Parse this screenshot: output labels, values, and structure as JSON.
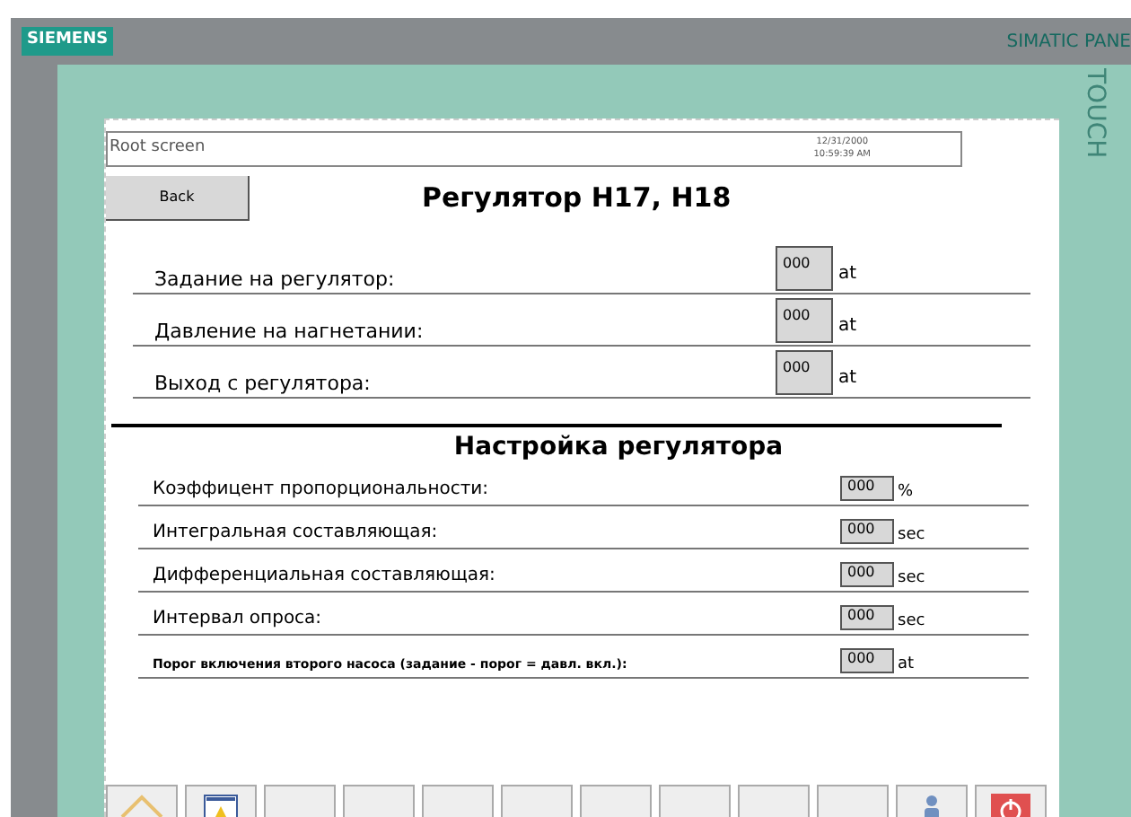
{
  "device": {
    "brand": "SIEMENS",
    "model": "SIMATIC PANE",
    "side_label": "TOUCH"
  },
  "header": {
    "screen_name": "Root screen",
    "date": "12/31/2000",
    "time": "10:59:39 AM"
  },
  "back_button": "Back",
  "title": "Регулятор H17, H18",
  "rows": [
    {
      "label": "Задание на регулятор:",
      "value": "000",
      "unit": "at"
    },
    {
      "label": "Давление на нагнетании:",
      "value": "000",
      "unit": "at"
    },
    {
      "label": "Выход с регулятора:",
      "value": "000",
      "unit": "at"
    }
  ],
  "section_title": "Настройка регулятора",
  "settings": [
    {
      "label": "Коэффицент пропорциональности:",
      "value": "000",
      "unit": "%",
      "small": false
    },
    {
      "label": "Интегральная составляющая:",
      "value": "000",
      "unit": "sec",
      "small": false
    },
    {
      "label": "Дифференциальная составляющая:",
      "value": "000",
      "unit": "sec",
      "small": false
    },
    {
      "label": "Интервал опроса:",
      "value": "000",
      "unit": "sec",
      "small": false
    },
    {
      "label": "Порог включения второго насоса (задание - порог = давл. вкл.):",
      "value": "000",
      "unit": "at",
      "small": true
    }
  ],
  "function_keys": [
    {
      "kind": "home"
    },
    {
      "kind": "alarm"
    },
    {
      "kind": "blank"
    },
    {
      "kind": "blank"
    },
    {
      "kind": "blank"
    },
    {
      "kind": "blank"
    },
    {
      "kind": "blank"
    },
    {
      "kind": "blank"
    },
    {
      "kind": "blank"
    },
    {
      "kind": "blank"
    },
    {
      "kind": "user"
    },
    {
      "kind": "power"
    }
  ]
}
